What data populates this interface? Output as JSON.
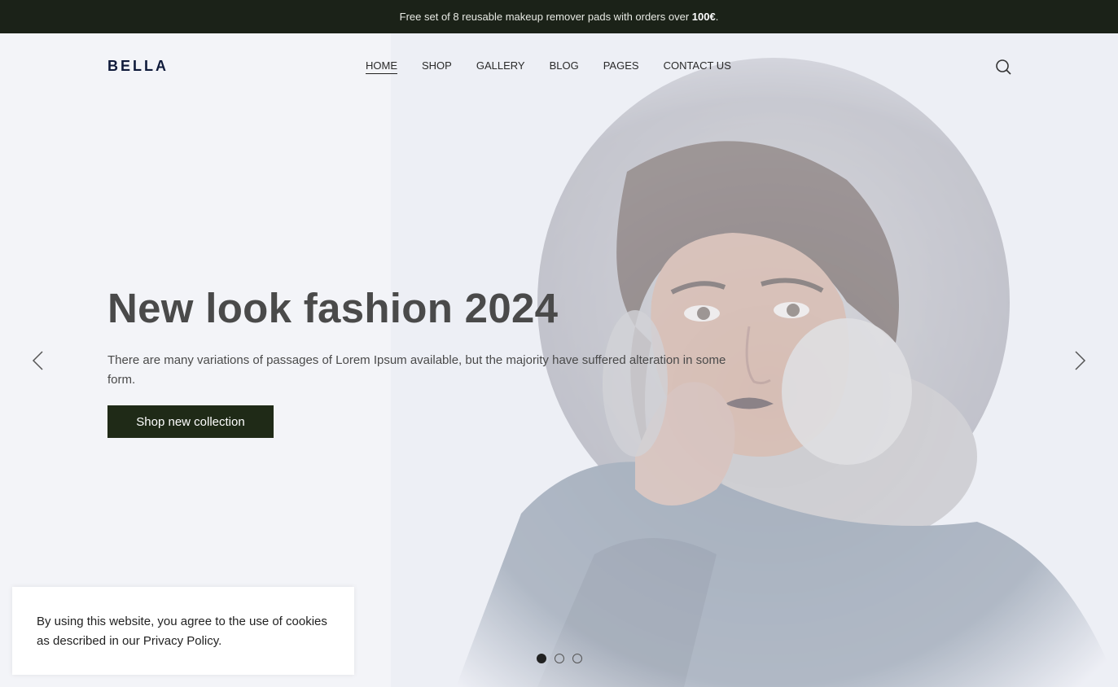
{
  "announcement": {
    "text": "Free set of 8 reusable makeup remover pads with orders over ",
    "amount": "100€",
    "suffix": "."
  },
  "header": {
    "logo": "BELLA",
    "nav": [
      "HOME",
      "SHOP",
      "GALLERY",
      "BLOG",
      "PAGES",
      "CONTACT US"
    ],
    "active_nav": "HOME",
    "search_icon": "search-icon"
  },
  "hero": {
    "title": "New look fashion 2024",
    "description": "There are many variations of passages of Lorem Ipsum available, but the majority have suffered alteration in some form.",
    "button_label": "Shop new collection",
    "prev_icon": "chevron-left-icon",
    "next_icon": "chevron-right-icon",
    "slides_total": 3,
    "active_slide": 1
  },
  "cookie": {
    "text": "By using this website, you agree to the use of cookies as described in our ",
    "link_label": "Privacy Policy",
    "suffix": "."
  },
  "colors": {
    "topbar_bg": "#1b2218",
    "button_bg": "#1f2a17",
    "hero_bg": "#f3f4f8",
    "logo": "#0f1a3a"
  }
}
